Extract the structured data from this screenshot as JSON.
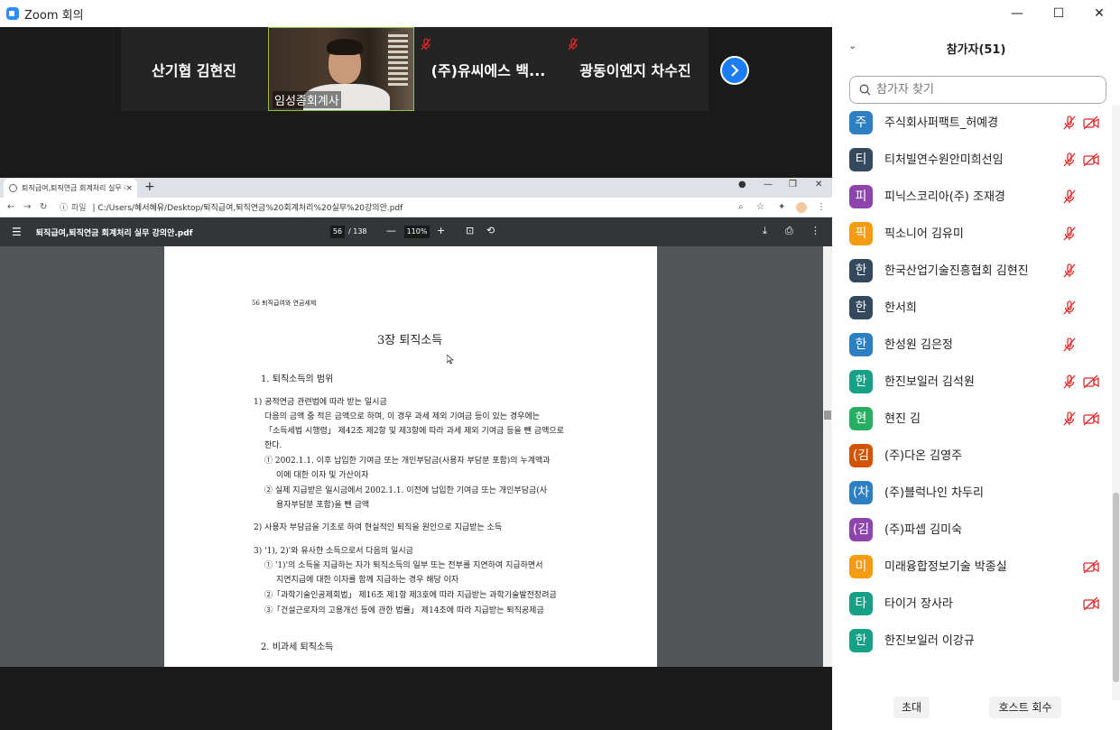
{
  "window": {
    "title": "Zoom 회의",
    "minimize": "—",
    "maximize": "☐",
    "close": "✕"
  },
  "video_strip": {
    "tiles": [
      {
        "name": "산기협 김현진"
      },
      {
        "name": "임성종회계사"
      },
      {
        "name": "(주)유씨에스 백..."
      },
      {
        "name": "광동이엔지 차수진"
      }
    ],
    "next": "›"
  },
  "browser": {
    "tab_title": "퇴직급여,퇴직연금 회계처리 실무 강의안.pdf",
    "tab_close": "×",
    "new_tab": "+",
    "url_label": "파일",
    "url": "C:/Users/혜서혜유/Desktop/퇴직급여,퇴직연금%20회계처리%20실무%20강의안.pdf",
    "pdf_title": "퇴직급여,퇴직연금 회계처리 실무 강의안.pdf",
    "page_current": "56",
    "page_total": "/ 138",
    "zoom": "110%",
    "zoom_minus": "—",
    "zoom_plus": "+"
  },
  "pdf_page": {
    "header": "56  퇴직급여와 연금세제",
    "chapter": "3장 퇴직소득",
    "section1": "1.  퇴직소득의 범위",
    "item1": "1)  공적연금 관련법에 따라 받는 일시금",
    "item1_l1": "다음의 금액 중 적은 금액으로 하며, 이 경우 과세 제외 기여금 등이 있는 경우에는",
    "item1_l2": "「소득세법 시행령」 제42조 제2항 및 제3항에 따라 과세 제외 기여금 등을 뺀 금액으로",
    "item1_l3": "한다.",
    "item1_a1": "①  2002.1.1. 이후 납입한 기여금 또는 개인부담금(사용자 부담분 포함)의 누계액과",
    "item1_a2": "이에 대한 이자 및 가산이자",
    "item1_b1": "②  실제 지급받은 일시금에서 2002.1.1. 이전에 납입한 기여금 또는 개인부담금(사",
    "item1_b2": "용자부담분 포함)을 뺀 금액",
    "item2": "2)  사용자 부담금을 기초로 하여 현실적인 퇴직을 원인으로 지급받는 소득",
    "item3": "3)  '1), 2)'와 유사한 소득으로서 다음의 일시금",
    "item3_a1": "①  '1)'의 소득을 지급하는 자가 퇴직소득의 일부 또는 전부를 지연하여 지급하면서",
    "item3_a2": "지연지급에 대한 이자를 함께 지급하는 경우 해당 이자",
    "item3_b": "②「과학기술인공제회법」 제16조 제1항 제3호에 따라 지급받는 과학기술발전장려금",
    "item3_c": "③「건설근로자의 고용개선 등에 관한 법률」 제14조에 따라 지급받는 퇴직공제금",
    "section2": "2.  비과세 퇴직소득"
  },
  "participants": {
    "title": "참가자(51)",
    "search_placeholder": "참가자 찾기",
    "items": [
      {
        "initial": "주",
        "name": "주식회사퍼팩트_허예경",
        "color": "#2e7ec2",
        "mic_muted": true,
        "video_off": true
      },
      {
        "initial": "티",
        "name": "티처빌연수원안미희선임",
        "color": "#34495e",
        "mic_muted": true,
        "video_off": true
      },
      {
        "initial": "피",
        "name": "피닉스코리아(주) 조재경",
        "color": "#8e44ad",
        "mic_muted": true,
        "video_off": false
      },
      {
        "initial": "픽",
        "name": "픽소니어 김유미",
        "color": "#f39c12",
        "mic_muted": true,
        "video_off": false
      },
      {
        "initial": "한",
        "name": "한국산업기술진흥협회 김현진",
        "color": "#34495e",
        "mic_muted": true,
        "video_off": false
      },
      {
        "initial": "한",
        "name": "한서희",
        "color": "#34495e",
        "mic_muted": true,
        "video_off": false
      },
      {
        "initial": "한",
        "name": "한성원 김은정",
        "color": "#2e7ec2",
        "mic_muted": true,
        "video_off": false
      },
      {
        "initial": "한",
        "name": "한진보일러 김석원",
        "color": "#16a085",
        "mic_muted": true,
        "video_off": true
      },
      {
        "initial": "현",
        "name": "현진 김",
        "color": "#27ae60",
        "mic_muted": true,
        "video_off": true
      },
      {
        "initial": "(김",
        "name": "(주)다온 김영주",
        "color": "#d35400",
        "mic_muted": false,
        "video_off": false
      },
      {
        "initial": "(차",
        "name": "(주)블럭나인 차두리",
        "color": "#2e7ec2",
        "mic_muted": false,
        "video_off": false
      },
      {
        "initial": "(김",
        "name": "(주)파셉 김미숙",
        "color": "#8e44ad",
        "mic_muted": false,
        "video_off": false
      },
      {
        "initial": "미",
        "name": "미래융합정보기술 박종실",
        "color": "#f39c12",
        "mic_muted": false,
        "video_off": true
      },
      {
        "initial": "타",
        "name": "타이거 장사라",
        "color": "#16a085",
        "mic_muted": false,
        "video_off": true
      },
      {
        "initial": "한",
        "name": "한진보일러 이강규",
        "color": "#16a085",
        "mic_muted": false,
        "video_off": false
      }
    ],
    "invite_label": "초대",
    "reclaim_host_label": "호스트 회수"
  }
}
